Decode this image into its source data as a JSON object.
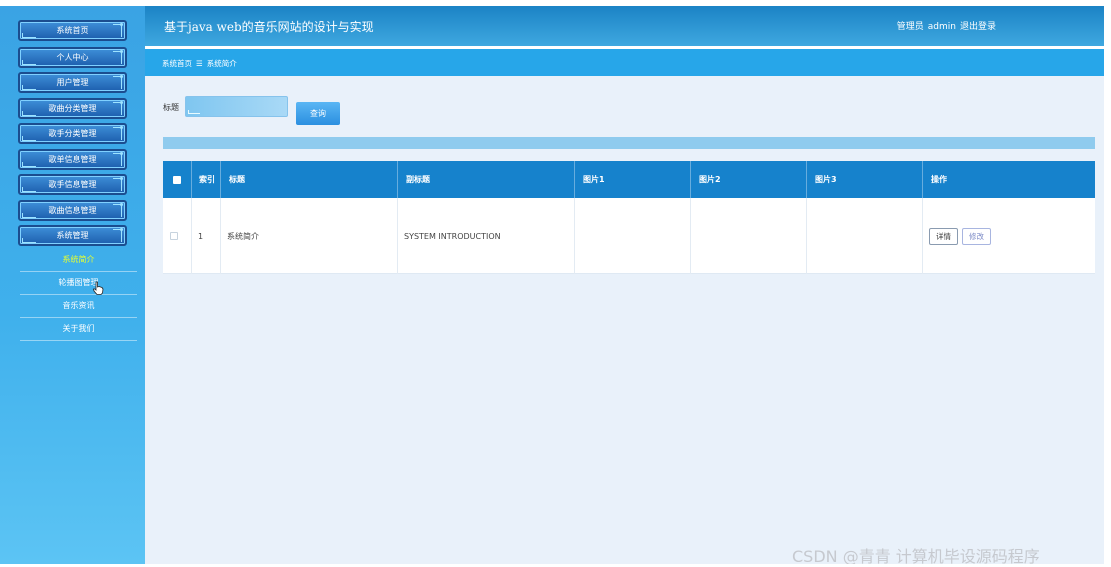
{
  "header": {
    "title": "基于java web的音乐网站的设计与实现",
    "role_label": "管理员",
    "username": "admin",
    "logout_label": "退出登录"
  },
  "sidebar": {
    "menu": [
      {
        "label": "系统首页"
      },
      {
        "label": "个人中心"
      },
      {
        "label": "用户管理"
      },
      {
        "label": "歌曲分类管理"
      },
      {
        "label": "歌手分类管理"
      },
      {
        "label": "歌单信息管理"
      },
      {
        "label": "歌手信息管理"
      },
      {
        "label": "歌曲信息管理"
      },
      {
        "label": "系统管理"
      }
    ],
    "submenu": [
      {
        "label": "系统简介",
        "active": true
      },
      {
        "label": "轮播图管理"
      },
      {
        "label": "音乐资讯"
      },
      {
        "label": "关于我们"
      }
    ]
  },
  "breadcrumb": {
    "home": "系统首页",
    "separator": "☰",
    "current": "系统简介"
  },
  "search": {
    "label": "标题",
    "value": "",
    "button_label": "查询"
  },
  "table": {
    "columns": [
      "索引",
      "标题",
      "副标题",
      "图片1",
      "图片2",
      "图片3",
      "操作"
    ],
    "rows": [
      {
        "index": "1",
        "title": "系统简介",
        "subtitle": "SYSTEM INTRODUCTION",
        "image1": "",
        "image2": "",
        "image3": "",
        "actions": [
          "详情",
          "修改"
        ]
      }
    ]
  },
  "watermark": "CSDN @青青  计算机毕设源码程序",
  "colors": {
    "sidebar": "#3aa3e4",
    "header": "#1b83c5",
    "breadcrumb_bar": "#27a6e9",
    "table_header": "#1682cc",
    "active_submenu": "#e7ff2e",
    "content_bg": "#e9f1fa"
  }
}
